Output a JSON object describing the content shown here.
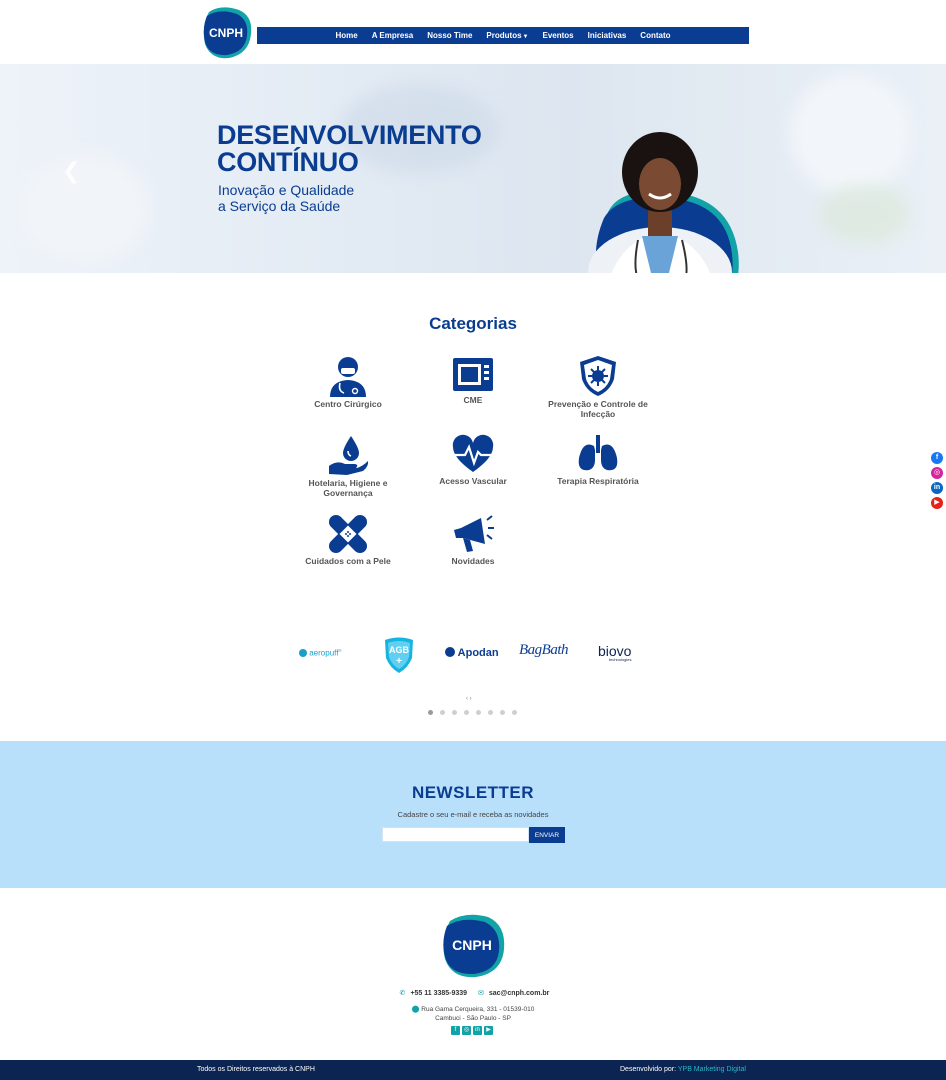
{
  "brand": {
    "logo_text": "CNPH"
  },
  "nav": {
    "items": [
      "Home",
      "A Empresa",
      "Nosso Time",
      "Produtos",
      "Eventos",
      "Iniciativas",
      "Contato"
    ]
  },
  "hero": {
    "title_line1": "DESENVOLVIMENTO",
    "title_line2": "CONTÍNUO",
    "subtitle_line1": "Inovação e Qualidade",
    "subtitle_line2": "a Serviço da Saúde",
    "prev_icon": "chevron-left-icon"
  },
  "categories": {
    "title": "Categorias",
    "items": [
      {
        "label": "Centro Cirúrgico",
        "icon": "surgeon-icon"
      },
      {
        "label": "CME",
        "icon": "sterilizer-icon"
      },
      {
        "label": "Prevenção e Controle de Infecção",
        "icon": "shield-virus-icon"
      },
      {
        "label": "Hotelaria, Higiene e Governança",
        "icon": "hand-drop-icon"
      },
      {
        "label": "Acesso Vascular",
        "icon": "heart-pulse-icon"
      },
      {
        "label": "Terapia Respiratória",
        "icon": "lungs-icon"
      },
      {
        "label": "Cuidados com a Pele",
        "icon": "bandage-icon"
      },
      {
        "label": "Novidades",
        "icon": "megaphone-icon"
      }
    ]
  },
  "brands": {
    "items": [
      "aeropuff",
      "AGB",
      "Apodan",
      "BagBath",
      "biovo"
    ],
    "aeropuff_tag": "®",
    "biovo_tag": "technologies",
    "arrows": "‹ ›",
    "dot_count": 8,
    "active_dot": 0
  },
  "newsletter": {
    "title": "NEWSLETTER",
    "subtitle": "Cadastre o seu e-mail e receba as novidades",
    "input_value": "",
    "button": "ENVIAR"
  },
  "footer": {
    "phone": "+55 11 3385-9339",
    "email": "sac@cnph.com.br",
    "address_line1": "Rua Gama Cerqueira, 331 - 01539-010",
    "address_line2": "Cambuci - São Paulo - SP",
    "social": [
      "facebook-icon",
      "instagram-icon",
      "linkedin-icon",
      "youtube-icon"
    ]
  },
  "bottom_bar": {
    "rights": "Todos os Direitos reservados à CNPH",
    "dev_prefix": "Desenvolvido por:",
    "dev_link": "YPB Marketing Digital"
  },
  "colors": {
    "primary": "#0a3d91",
    "accent": "#12a3a8",
    "newsletter_bg": "#b9e0fb",
    "bottom_bg": "#0b2452"
  }
}
